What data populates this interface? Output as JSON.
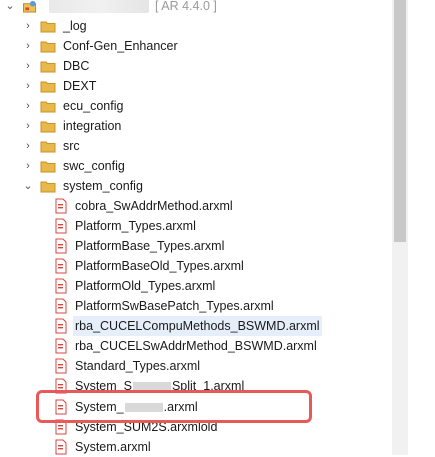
{
  "project": {
    "badge": "[ AR 4.4.0 ]"
  },
  "folders": [
    {
      "label": "_log"
    },
    {
      "label": "Conf-Gen_Enhancer"
    },
    {
      "label": "DBC"
    },
    {
      "label": "DEXT"
    },
    {
      "label": "ecu_config"
    },
    {
      "label": "integration"
    },
    {
      "label": "src"
    },
    {
      "label": "swc_config"
    },
    {
      "label": "system_config"
    }
  ],
  "files": [
    {
      "label": "cobra_SwAddrMethod.arxml"
    },
    {
      "label": "Platform_Types.arxml"
    },
    {
      "label": "PlatformBase_Types.arxml"
    },
    {
      "label": "PlatformBaseOld_Types.arxml"
    },
    {
      "label": "PlatformOld_Types.arxml"
    },
    {
      "label": "PlatformSwBasePatch_Types.arxml"
    },
    {
      "label": "rba_CUCELCompuMethods_BSWMD.arxml"
    },
    {
      "label": "rba_CUCELSwAddrMethod_BSWMD.arxml"
    },
    {
      "label": "Standard_Types.arxml"
    },
    {
      "label": "System_S",
      "label_suffix": "Split_1.arxml"
    },
    {
      "label": "System_",
      "label_suffix": ".arxml"
    },
    {
      "label": "System_SUM2S.arxmlold"
    },
    {
      "label": "System.arxml"
    }
  ],
  "colors": {
    "folder": "#e8b84a",
    "folder_dark": "#c99526",
    "file_red": "#d9443c",
    "highlight": "#e8595a"
  }
}
